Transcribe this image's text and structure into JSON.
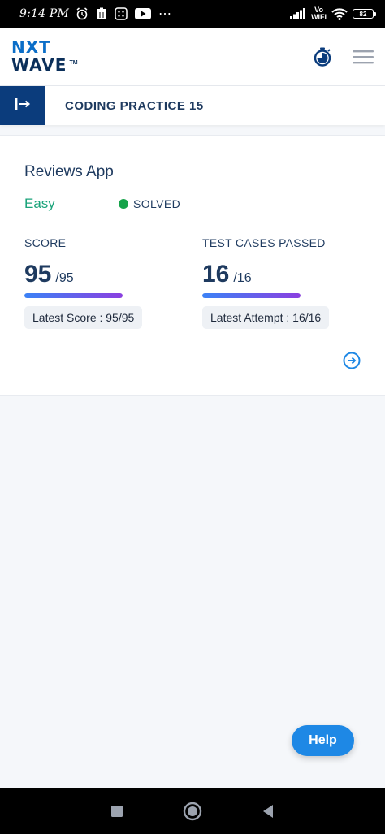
{
  "status_bar": {
    "time": "9:14 PM",
    "volte_line1": "Vo",
    "volte_line2": "WiFi",
    "battery": "82",
    "more": "⋯",
    "icons": [
      "alarm-icon",
      "trash-icon",
      "app-icon",
      "youtube-icon",
      "signal-icon",
      "wifi-icon",
      "battery-icon"
    ]
  },
  "header": {
    "logo_line1": "NXT",
    "logo_line2": "WAVE",
    "logo_tm": "TM",
    "icons": [
      "timer-icon",
      "menu-icon"
    ]
  },
  "sub_header": {
    "title": "CODING PRACTICE 15",
    "icon": "expand-icon"
  },
  "problem": {
    "title": "Reviews App",
    "difficulty": "Easy",
    "status": "SOLVED",
    "status_color": "#16a34a",
    "score": {
      "label": "SCORE",
      "value": "95",
      "total": "/95",
      "progress": 1.0,
      "latest": "Latest Score : 95/95"
    },
    "tests": {
      "label": "TEST CASES PASSED",
      "value": "16",
      "total": "/16",
      "progress": 1.0,
      "latest": "Latest Attempt : 16/16"
    },
    "next_icon": "arrow-right-circle-icon"
  },
  "help": {
    "label": "Help"
  },
  "nav": {
    "icons": [
      "recents-icon",
      "home-icon",
      "back-icon"
    ]
  },
  "colors": {
    "brand_dark": "#0b3c7c",
    "accent": "#1e88e5",
    "easy": "#1aa37a"
  }
}
